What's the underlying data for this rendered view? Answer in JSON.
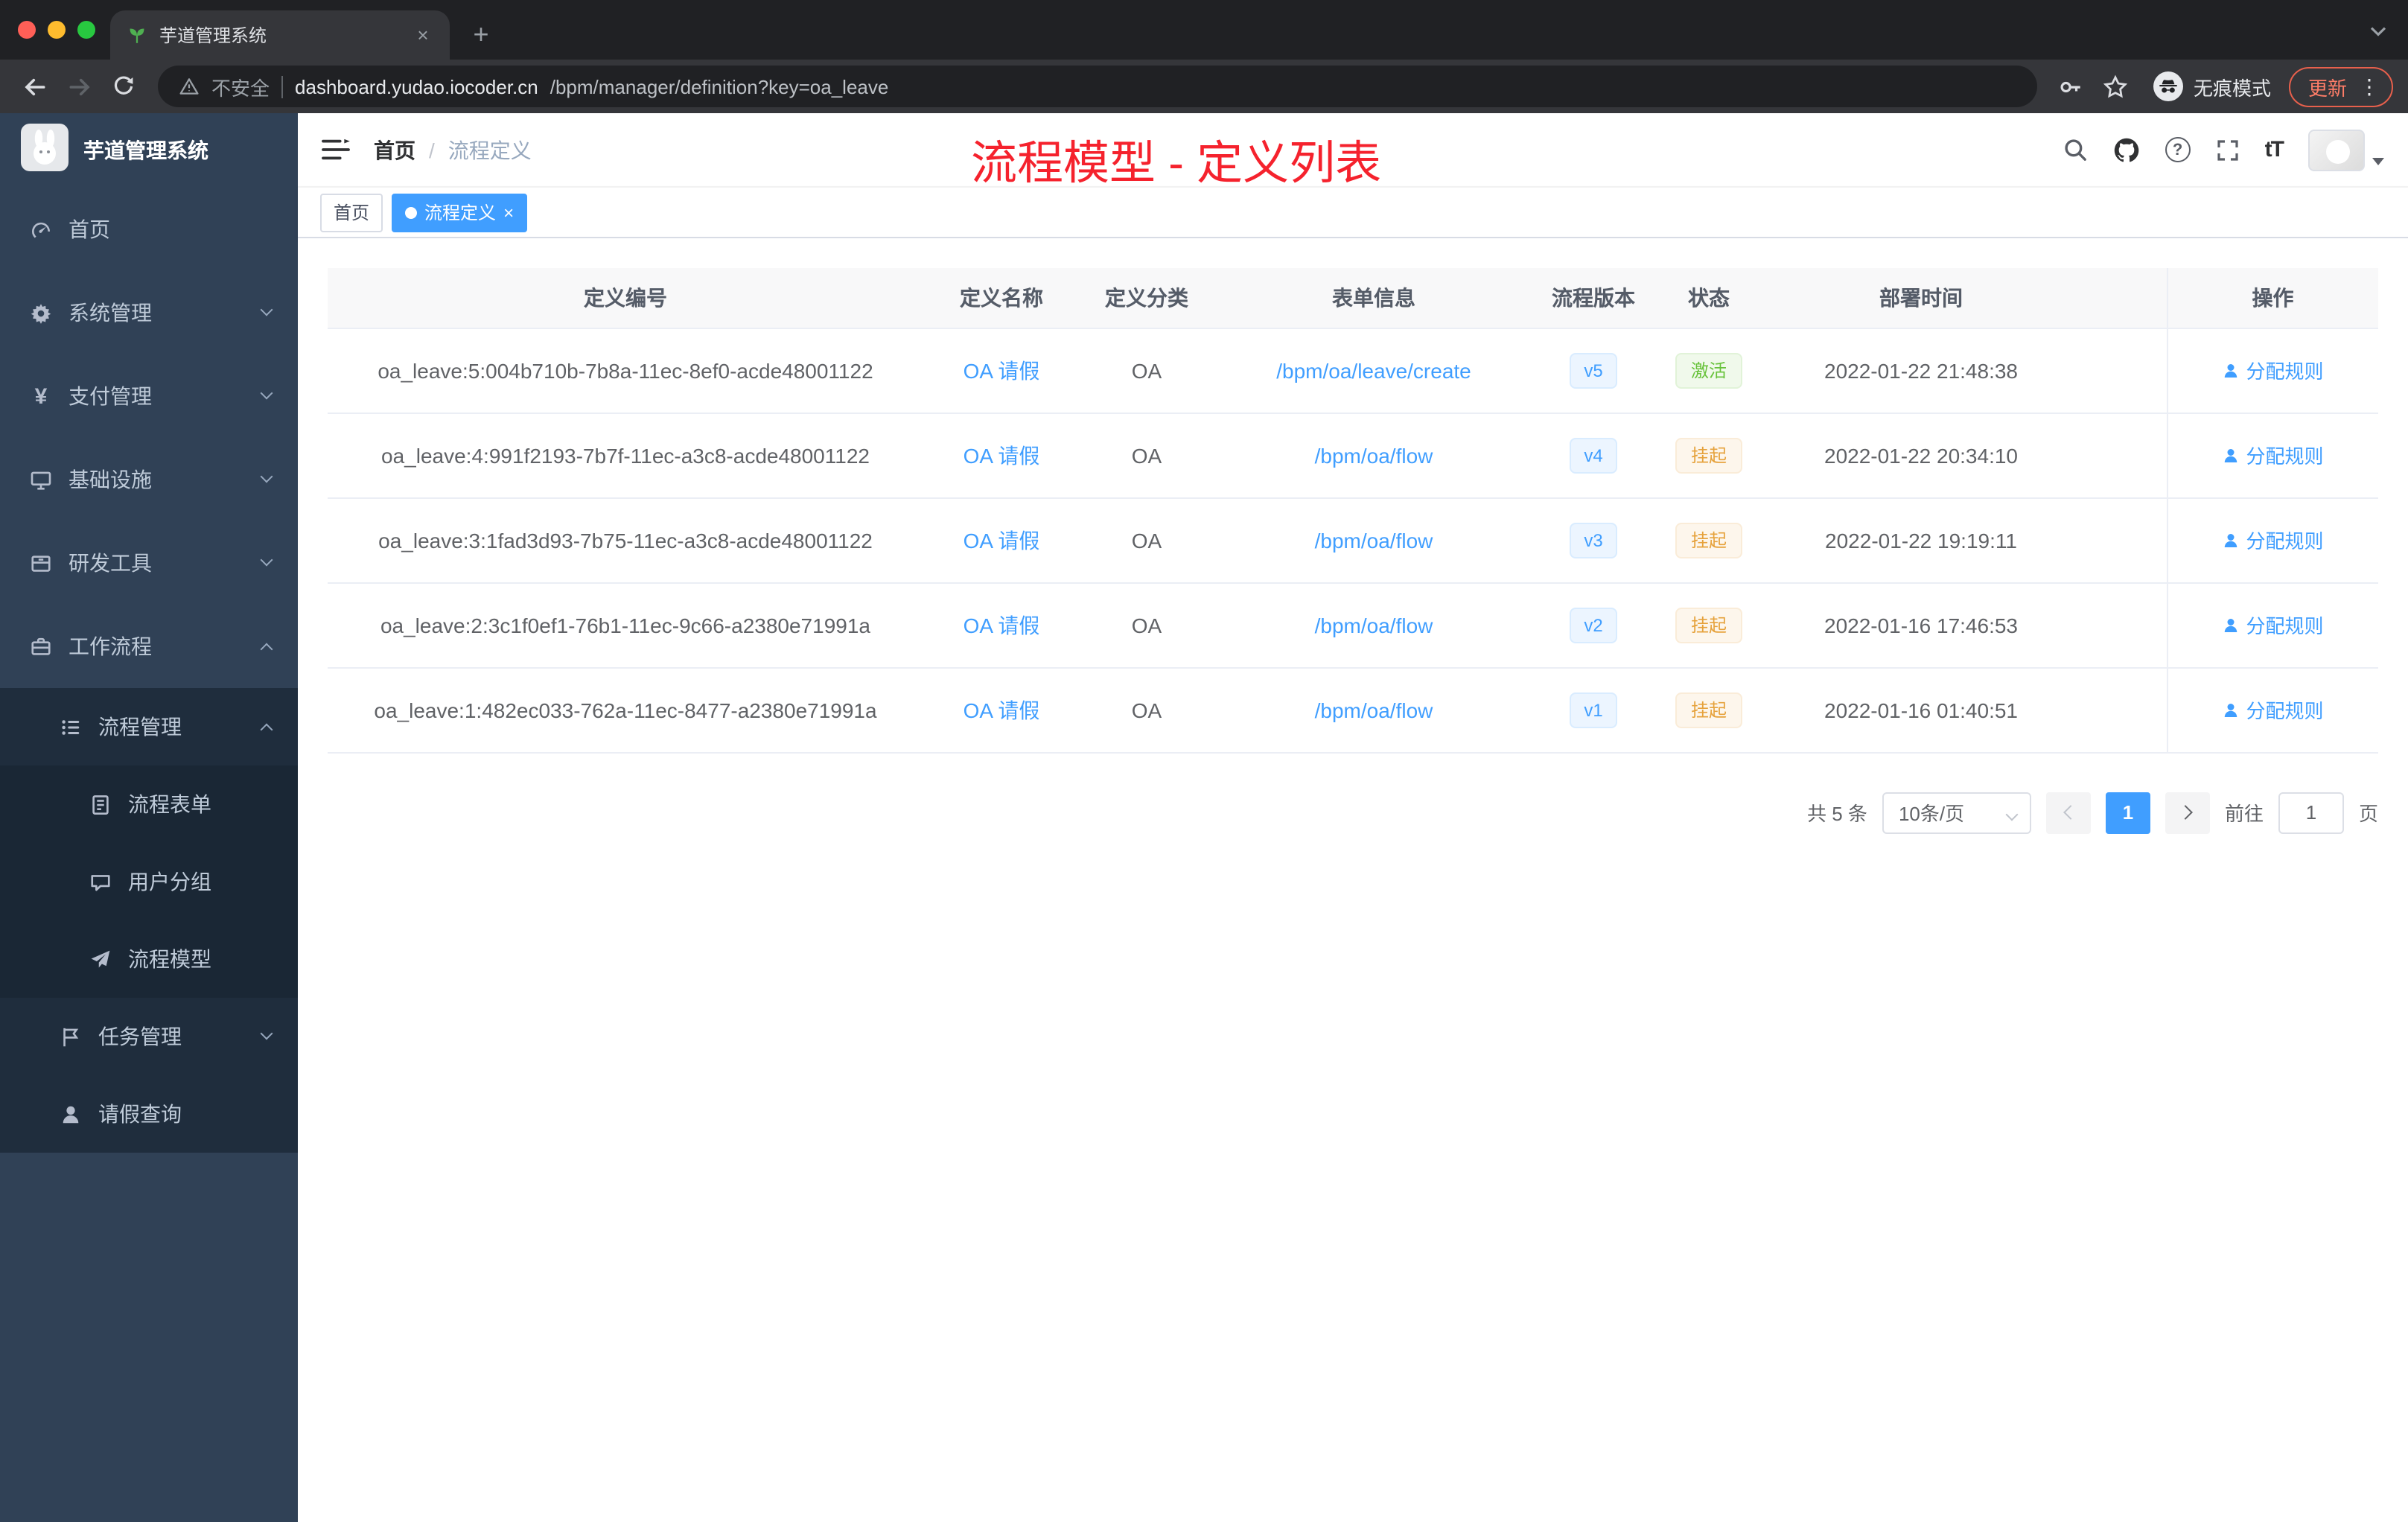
{
  "colors": {
    "accent": "#409eff",
    "success": "#67c23a",
    "warning": "#e6a23c",
    "annotation_red": "#f5222d",
    "sidebar_bg": "#304156"
  },
  "glyphs": {
    "tab_close": "×",
    "new_tab": "+",
    "menu_dots": "⋮",
    "yen": "¥",
    "font_size": "tT",
    "question_mark": "?",
    "breadcrumb_sep": "/",
    "tag_close": "×"
  },
  "browser": {
    "tab": {
      "title": "芋道管理系统"
    },
    "toolbar": {
      "security_label": "不安全",
      "url_domain": "dashboard.yudao.iocoder.cn",
      "url_path": "/bpm/manager/definition?key=oa_leave",
      "incognito_label": "无痕模式",
      "update_label": "更新"
    }
  },
  "annotation": {
    "text": "流程模型 - 定义列表"
  },
  "app": {
    "logo_title": "芋道管理系统",
    "breadcrumb": {
      "home": "首页",
      "current": "流程定义"
    },
    "tags": {
      "home": "首页",
      "active": "流程定义"
    },
    "sidebar": [
      {
        "label": "首页"
      },
      {
        "label": "系统管理"
      },
      {
        "label": "支付管理"
      },
      {
        "label": "基础设施"
      },
      {
        "label": "研发工具"
      },
      {
        "label": "工作流程"
      },
      {
        "label": "流程管理"
      },
      {
        "label": "流程表单"
      },
      {
        "label": "用户分组"
      },
      {
        "label": "流程模型"
      },
      {
        "label": "任务管理"
      },
      {
        "label": "请假查询"
      }
    ]
  },
  "table": {
    "columns": [
      "定义编号",
      "定义名称",
      "定义分类",
      "表单信息",
      "流程版本",
      "状态",
      "部署时间",
      "操作"
    ],
    "action_label": "分配规则",
    "rows": [
      {
        "id": "oa_leave:5:004b710b-7b8a-11ec-8ef0-acde48001122",
        "name": "OA 请假",
        "category": "OA",
        "form": "/bpm/oa/leave/create",
        "version": "v5",
        "status": "激活",
        "time": "2022-01-22 21:48:38"
      },
      {
        "id": "oa_leave:4:991f2193-7b7f-11ec-a3c8-acde48001122",
        "name": "OA 请假",
        "category": "OA",
        "form": "/bpm/oa/flow",
        "version": "v4",
        "status": "挂起",
        "time": "2022-01-22 20:34:10"
      },
      {
        "id": "oa_leave:3:1fad3d93-7b75-11ec-a3c8-acde48001122",
        "name": "OA 请假",
        "category": "OA",
        "form": "/bpm/oa/flow",
        "version": "v3",
        "status": "挂起",
        "time": "2022-01-22 19:19:11"
      },
      {
        "id": "oa_leave:2:3c1f0ef1-76b1-11ec-9c66-a2380e71991a",
        "name": "OA 请假",
        "category": "OA",
        "form": "/bpm/oa/flow",
        "version": "v2",
        "status": "挂起",
        "time": "2022-01-16 17:46:53"
      },
      {
        "id": "oa_leave:1:482ec033-762a-11ec-8477-a2380e71991a",
        "name": "OA 请假",
        "category": "OA",
        "form": "/bpm/oa/flow",
        "version": "v1",
        "status": "挂起",
        "time": "2022-01-16 01:40:51"
      }
    ]
  },
  "pagination": {
    "total": "共 5 条",
    "page_size": "10条/页",
    "current_page": "1",
    "goto_label": "前往",
    "goto_value": "1",
    "page_unit": "页"
  }
}
